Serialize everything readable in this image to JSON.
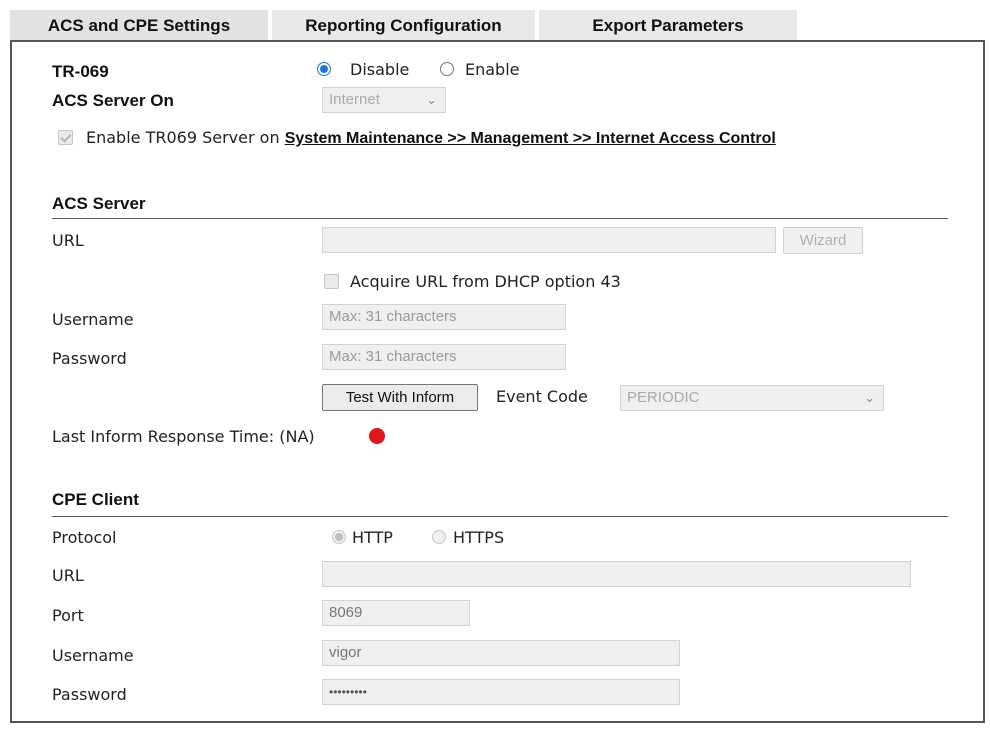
{
  "tabs": [
    {
      "label": "ACS and CPE Settings",
      "active": true
    },
    {
      "label": "Reporting Configuration",
      "active": false
    },
    {
      "label": "Export Parameters",
      "active": false
    }
  ],
  "tr069": {
    "label": "TR-069",
    "options": [
      {
        "label": "Disable",
        "selected": true
      },
      {
        "label": "Enable",
        "selected": false
      }
    ]
  },
  "acs_server_on": {
    "label": "ACS Server On",
    "value": "Internet"
  },
  "enable_tr069": {
    "checked": true,
    "text": "Enable TR069 Server on",
    "link": "System Maintenance >> Management >> Internet Access Control"
  },
  "acs_server": {
    "title": "ACS Server",
    "url_label": "URL",
    "url_value": "",
    "wizard_label": "Wizard",
    "dhcp_label": "Acquire URL from DHCP option 43",
    "username_label": "Username",
    "username_placeholder": "Max: 31 characters",
    "password_label": "Password",
    "password_placeholder": "Max: 31 characters",
    "test_button": "Test With Inform",
    "event_code_label": "Event Code",
    "event_code_value": "PERIODIC",
    "last_inform_label": "Last Inform Response Time:",
    "last_inform_value": "(NA)",
    "status_color": "#e0161b"
  },
  "cpe_client": {
    "title": "CPE Client",
    "protocol_label": "Protocol",
    "protocol_options": [
      {
        "label": "HTTP",
        "selected": true
      },
      {
        "label": "HTTPS",
        "selected": false
      }
    ],
    "url_label": "URL",
    "url_value": "",
    "port_label": "Port",
    "port_value": "8069",
    "username_label": "Username",
    "username_value": "vigor",
    "password_label": "Password",
    "password_value": "•••••••••"
  }
}
